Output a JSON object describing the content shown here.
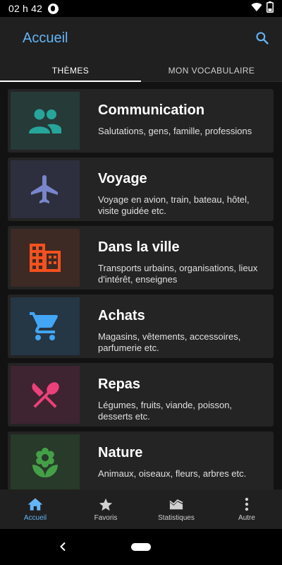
{
  "status_bar": {
    "time": "02 h 42"
  },
  "app_bar": {
    "title": "Accueil",
    "search_icon": "search-icon"
  },
  "tabs": [
    {
      "label": "THÈMES",
      "active": true
    },
    {
      "label": "MON VOCABULAIRE",
      "active": false
    }
  ],
  "themes": [
    {
      "title": "Communication",
      "description": "Salutations, gens, famille, professions",
      "icon": "people-icon",
      "icon_color": "#26a69a",
      "bg_color": "#263a38"
    },
    {
      "title": "Voyage",
      "description": "Voyage en avion, train, bateau, hôtel, visite guidée etc.",
      "icon": "airplane-icon",
      "icon_color": "#7986cb",
      "bg_color": "#2d2f3e"
    },
    {
      "title": "Dans la ville",
      "description": "Transports urbains, organisations, lieux d'intérêt, enseignes",
      "icon": "building-icon",
      "icon_color": "#f4511e",
      "bg_color": "#3d2a24"
    },
    {
      "title": "Achats",
      "description": "Magasins, vêtements, accessoires, parfumerie etc.",
      "icon": "cart-icon",
      "icon_color": "#42a5f5",
      "bg_color": "#253645"
    },
    {
      "title": "Repas",
      "description": "Légumes, fruits, viande, poisson, desserts etc.",
      "icon": "fork-spoon-icon",
      "icon_color": "#ec407a",
      "bg_color": "#3d2430"
    },
    {
      "title": "Nature",
      "description": "Animaux, oiseaux, fleurs, arbres etc.",
      "icon": "flower-icon",
      "icon_color": "#43a047",
      "bg_color": "#283a29"
    }
  ],
  "bottom_nav": [
    {
      "label": "Accueil",
      "icon": "home-icon",
      "active": true
    },
    {
      "label": "Favoris",
      "icon": "star-icon",
      "active": false
    },
    {
      "label": "Statistiques",
      "icon": "chart-icon",
      "active": false
    },
    {
      "label": "Autre",
      "icon": "more-vert-icon",
      "active": false
    }
  ],
  "colors": {
    "accent": "#64b5f6",
    "surface": "#202020",
    "card": "#242424",
    "background": "#121212"
  }
}
